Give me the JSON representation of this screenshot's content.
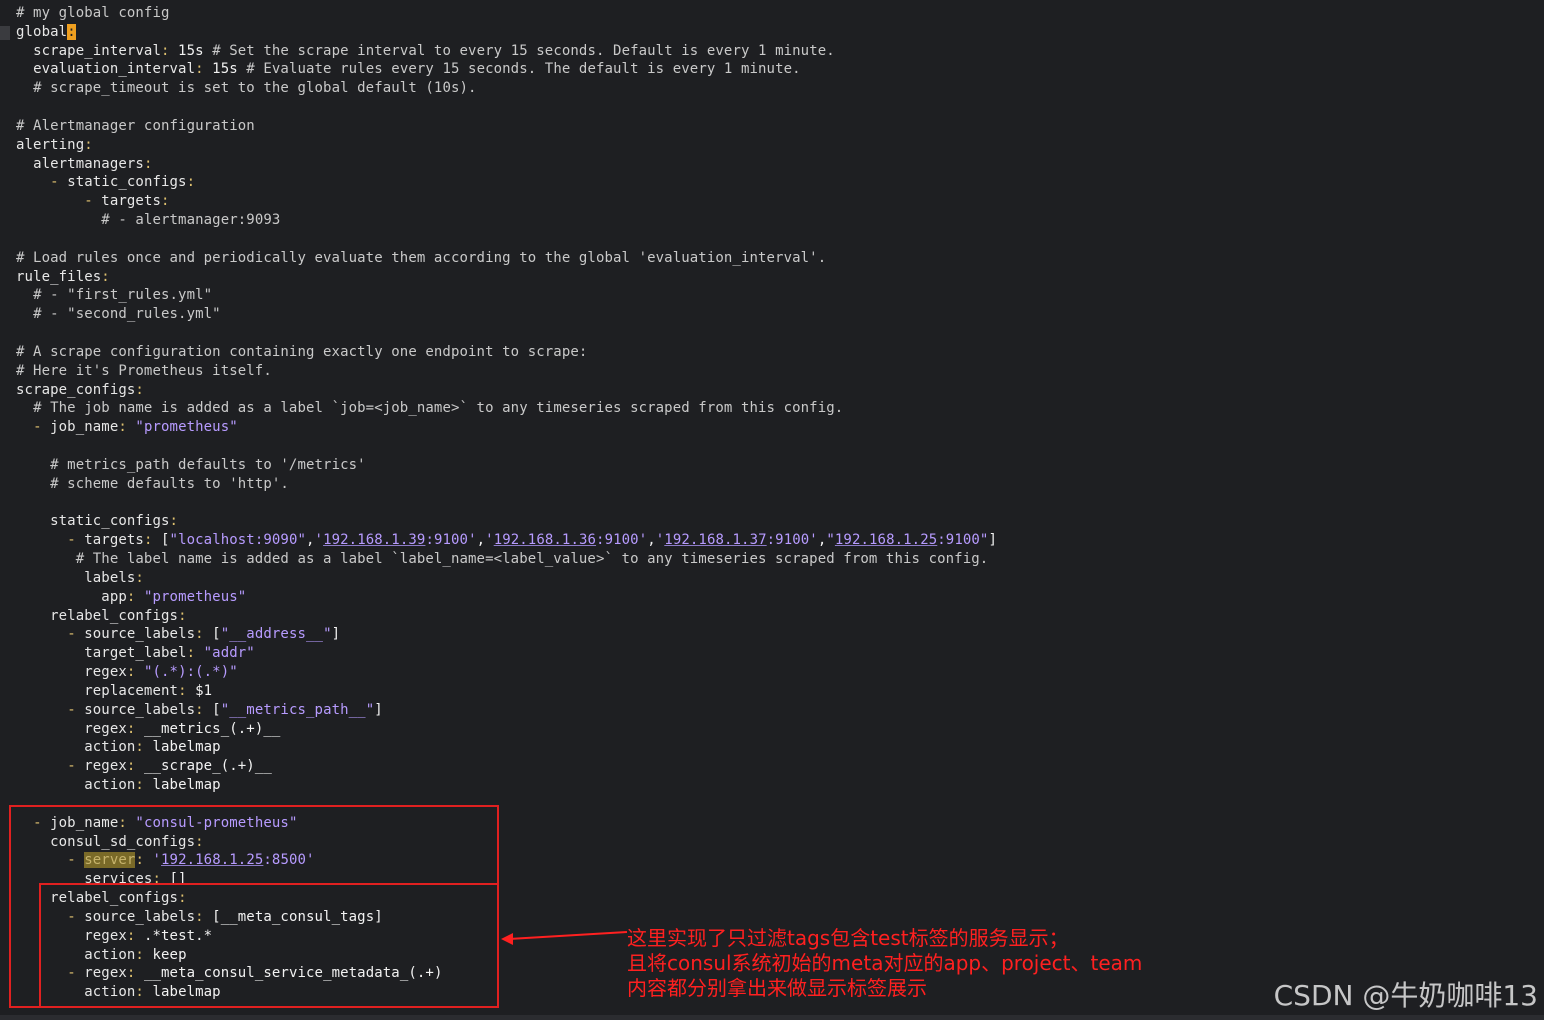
{
  "editor": {
    "lines": [
      [
        [
          "c",
          "# my global config"
        ]
      ],
      [
        [
          "k",
          "global"
        ],
        [
          "cursor",
          ":"
        ]
      ],
      [
        [
          "v",
          "  "
        ],
        [
          "k",
          "scrape_interval"
        ],
        [
          "p",
          ":"
        ],
        [
          "v",
          " 15s "
        ],
        [
          "c",
          "# Set the scrape interval to every 15 seconds. Default is every 1 minute."
        ]
      ],
      [
        [
          "v",
          "  "
        ],
        [
          "k",
          "evaluation_interval"
        ],
        [
          "p",
          ":"
        ],
        [
          "v",
          " 15s "
        ],
        [
          "c",
          "# Evaluate rules every 15 seconds. The default is every 1 minute."
        ]
      ],
      [
        [
          "v",
          "  "
        ],
        [
          "c",
          "# scrape_timeout is set to the global default (10s)."
        ]
      ],
      [],
      [
        [
          "c",
          "# Alertmanager configuration"
        ]
      ],
      [
        [
          "k",
          "alerting"
        ],
        [
          "p",
          ":"
        ]
      ],
      [
        [
          "v",
          "  "
        ],
        [
          "k",
          "alertmanagers"
        ],
        [
          "p",
          ":"
        ]
      ],
      [
        [
          "v",
          "    "
        ],
        [
          "d",
          "- "
        ],
        [
          "k",
          "static_configs"
        ],
        [
          "p",
          ":"
        ]
      ],
      [
        [
          "v",
          "        "
        ],
        [
          "d",
          "- "
        ],
        [
          "k",
          "targets"
        ],
        [
          "p",
          ":"
        ]
      ],
      [
        [
          "v",
          "          "
        ],
        [
          "c",
          "# - alertmanager:9093"
        ]
      ],
      [],
      [
        [
          "c",
          "# Load rules once and periodically evaluate them according to the global 'evaluation_interval'."
        ]
      ],
      [
        [
          "k",
          "rule_files"
        ],
        [
          "p",
          ":"
        ]
      ],
      [
        [
          "v",
          "  "
        ],
        [
          "c",
          "# - \"first_rules.yml\""
        ]
      ],
      [
        [
          "v",
          "  "
        ],
        [
          "c",
          "# - \"second_rules.yml\""
        ]
      ],
      [],
      [
        [
          "c",
          "# A scrape configuration containing exactly one endpoint to scrape:"
        ]
      ],
      [
        [
          "c",
          "# Here it's Prometheus itself."
        ]
      ],
      [
        [
          "k",
          "scrape_configs"
        ],
        [
          "p",
          ":"
        ]
      ],
      [
        [
          "v",
          "  "
        ],
        [
          "c",
          "# The job name is added as a label `job=<job_name>` to any timeseries scraped from this config."
        ]
      ],
      [
        [
          "v",
          "  "
        ],
        [
          "d",
          "- "
        ],
        [
          "k",
          "job_name"
        ],
        [
          "p",
          ":"
        ],
        [
          "v",
          " "
        ],
        [
          "s",
          "\"prometheus\""
        ]
      ],
      [],
      [
        [
          "v",
          "    "
        ],
        [
          "c",
          "# metrics_path defaults to '/metrics'"
        ]
      ],
      [
        [
          "v",
          "    "
        ],
        [
          "c",
          "# scheme defaults to 'http'."
        ]
      ],
      [],
      [
        [
          "v",
          "    "
        ],
        [
          "k",
          "static_configs"
        ],
        [
          "p",
          ":"
        ]
      ],
      [
        [
          "v",
          "      "
        ],
        [
          "d",
          "- "
        ],
        [
          "k",
          "targets"
        ],
        [
          "p",
          ":"
        ],
        [
          "v",
          " ["
        ],
        [
          "s",
          "\"localhost:9090\""
        ],
        [
          "v",
          ","
        ],
        [
          "s",
          "'"
        ],
        [
          "su",
          "192.168.1.39"
        ],
        [
          "s",
          ":9100'"
        ],
        [
          "v",
          ","
        ],
        [
          "s",
          "'"
        ],
        [
          "su",
          "192.168.1.36"
        ],
        [
          "s",
          ":9100'"
        ],
        [
          "v",
          ","
        ],
        [
          "s",
          "'"
        ],
        [
          "su",
          "192.168.1.37"
        ],
        [
          "s",
          ":9100'"
        ],
        [
          "v",
          ","
        ],
        [
          "s",
          "\""
        ],
        [
          "su",
          "192.168.1.25"
        ],
        [
          "s",
          ":9100\""
        ],
        [
          "v",
          "]"
        ]
      ],
      [
        [
          "v",
          "       "
        ],
        [
          "c",
          "# The label name is added as a label `label_name=<label_value>` to any timeseries scraped from this config."
        ]
      ],
      [
        [
          "v",
          "        "
        ],
        [
          "k",
          "labels"
        ],
        [
          "p",
          ":"
        ]
      ],
      [
        [
          "v",
          "          "
        ],
        [
          "k",
          "app"
        ],
        [
          "p",
          ":"
        ],
        [
          "v",
          " "
        ],
        [
          "s",
          "\"prometheus\""
        ]
      ],
      [
        [
          "v",
          "    "
        ],
        [
          "k",
          "relabel_configs"
        ],
        [
          "p",
          ":"
        ]
      ],
      [
        [
          "v",
          "      "
        ],
        [
          "d",
          "- "
        ],
        [
          "k",
          "source_labels"
        ],
        [
          "p",
          ":"
        ],
        [
          "v",
          " ["
        ],
        [
          "s",
          "\"__address__\""
        ],
        [
          "v",
          "]"
        ]
      ],
      [
        [
          "v",
          "        "
        ],
        [
          "k",
          "target_label"
        ],
        [
          "p",
          ":"
        ],
        [
          "v",
          " "
        ],
        [
          "s",
          "\"addr\""
        ]
      ],
      [
        [
          "v",
          "        "
        ],
        [
          "k",
          "regex"
        ],
        [
          "p",
          ":"
        ],
        [
          "v",
          " "
        ],
        [
          "s",
          "\"(.*):(.*)\""
        ]
      ],
      [
        [
          "v",
          "        "
        ],
        [
          "k",
          "replacement"
        ],
        [
          "p",
          ":"
        ],
        [
          "v",
          " $1"
        ]
      ],
      [
        [
          "v",
          "      "
        ],
        [
          "d",
          "- "
        ],
        [
          "k",
          "source_labels"
        ],
        [
          "p",
          ":"
        ],
        [
          "v",
          " ["
        ],
        [
          "s",
          "\"__metrics_path__\""
        ],
        [
          "v",
          "]"
        ]
      ],
      [
        [
          "v",
          "        "
        ],
        [
          "k",
          "regex"
        ],
        [
          "p",
          ":"
        ],
        [
          "v",
          " __metrics_(.+)__"
        ]
      ],
      [
        [
          "v",
          "        "
        ],
        [
          "k",
          "action"
        ],
        [
          "p",
          ":"
        ],
        [
          "v",
          " labelmap"
        ]
      ],
      [
        [
          "v",
          "      "
        ],
        [
          "d",
          "- "
        ],
        [
          "k",
          "regex"
        ],
        [
          "p",
          ":"
        ],
        [
          "v",
          " __scrape_(.+)__"
        ]
      ],
      [
        [
          "v",
          "        "
        ],
        [
          "k",
          "action"
        ],
        [
          "p",
          ":"
        ],
        [
          "v",
          " labelmap"
        ]
      ],
      [],
      [
        [
          "v",
          "  "
        ],
        [
          "d",
          "- "
        ],
        [
          "k",
          "job_name"
        ],
        [
          "p",
          ":"
        ],
        [
          "v",
          " "
        ],
        [
          "s",
          "\"consul-prometheus\""
        ]
      ],
      [
        [
          "v",
          "    "
        ],
        [
          "k",
          "consul_sd_configs"
        ],
        [
          "p",
          ":"
        ]
      ],
      [
        [
          "v",
          "      "
        ],
        [
          "d",
          "- "
        ],
        [
          "hl",
          "server"
        ],
        [
          "p",
          ":"
        ],
        [
          "v",
          " "
        ],
        [
          "s",
          "'"
        ],
        [
          "su",
          "192.168.1.25"
        ],
        [
          "s",
          ":8500'"
        ]
      ],
      [
        [
          "v",
          "        "
        ],
        [
          "k",
          "services"
        ],
        [
          "p",
          ":"
        ],
        [
          "v",
          " []"
        ]
      ],
      [
        [
          "v",
          "    "
        ],
        [
          "k",
          "relabel_configs"
        ],
        [
          "p",
          ":"
        ]
      ],
      [
        [
          "v",
          "      "
        ],
        [
          "d",
          "- "
        ],
        [
          "k",
          "source_labels"
        ],
        [
          "p",
          ":"
        ],
        [
          "v",
          " [__meta_consul_tags]"
        ]
      ],
      [
        [
          "v",
          "        "
        ],
        [
          "k",
          "regex"
        ],
        [
          "p",
          ":"
        ],
        [
          "v",
          " .*test.*"
        ]
      ],
      [
        [
          "v",
          "        "
        ],
        [
          "k",
          "action"
        ],
        [
          "p",
          ":"
        ],
        [
          "v",
          " keep"
        ]
      ],
      [
        [
          "v",
          "      "
        ],
        [
          "d",
          "- "
        ],
        [
          "k",
          "regex"
        ],
        [
          "p",
          ":"
        ],
        [
          "v",
          " __meta_consul_service_metadata_(.+)"
        ]
      ],
      [
        [
          "v",
          "        "
        ],
        [
          "k",
          "action"
        ],
        [
          "p",
          ":"
        ],
        [
          "v",
          " labelmap"
        ]
      ]
    ]
  },
  "annotation": {
    "line1": "这里实现了只过滤tags包含test标签的服务显示；",
    "line2": "且将consul系统初始的meta对应的app、project、team",
    "line3": "内容都分别拿出来做显示标签展示"
  },
  "watermark": "CSDN @牛奶咖啡13",
  "colors": {
    "annotation": "#ff2020",
    "background": "#1e1f22"
  }
}
